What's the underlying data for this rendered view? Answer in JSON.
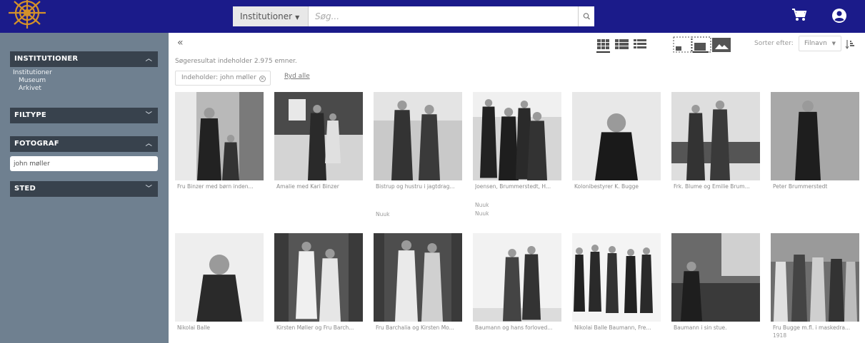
{
  "header": {
    "search_select": "Institutioner",
    "search_placeholder": "Søg..."
  },
  "sidebar": {
    "institutioner": {
      "title": "INSTITUTIONER",
      "root": "Institutioner",
      "items": [
        "Museum",
        "Arkivet"
      ]
    },
    "filtype": {
      "title": "FILTYPE"
    },
    "fotograf": {
      "title": "FOTOGRAF",
      "value": "john møller"
    },
    "sted": {
      "title": "STED"
    }
  },
  "results": {
    "summary": "Søgeresultat indeholder 2.975 emner.",
    "chip": "Indeholder: john møller",
    "clear_all": "Ryd alle"
  },
  "sort": {
    "label": "Sorter efter:",
    "value": "Filnavn"
  },
  "items": [
    {
      "caption": "Fru Binzer med børn inden...",
      "meta": []
    },
    {
      "caption": "Amalie med Kari Binzer",
      "meta": []
    },
    {
      "caption": "Bistrup og hustru i jagtdrag...",
      "meta": [
        "Nuuk"
      ]
    },
    {
      "caption": "Joensen, Brummerstedt, H...",
      "meta": [
        "Nuuk",
        "Nuuk"
      ]
    },
    {
      "caption": "Kolonibestyrer K. Bugge",
      "meta": []
    },
    {
      "caption": "Frk. Blume og Emilie Brum...",
      "meta": []
    },
    {
      "caption": "Peter Brummerstedt",
      "meta": []
    },
    {
      "caption": "Nikolai Balle",
      "meta": []
    },
    {
      "caption": "Kirsten Møller og Fru Barch...",
      "meta": []
    },
    {
      "caption": "Fru Barchalia og Kirsten Mo...",
      "meta": []
    },
    {
      "caption": "Baumann og hans forloved...",
      "meta": []
    },
    {
      "caption": "Nikolai Balle Baumann, Fre...",
      "meta": []
    },
    {
      "caption": "Baumann i sin stue.",
      "meta": []
    },
    {
      "caption": "Fru Bugge m.fl. i maskedra...",
      "meta": [
        "1918"
      ]
    }
  ],
  "colors": {
    "header": "#1b1b8a",
    "sidebar": "#6f8090",
    "filter_head": "#38424d",
    "logo": "#d4912a"
  },
  "icons": [
    "logo-icon",
    "caret-down-icon",
    "search-icon",
    "cart-icon",
    "user-icon",
    "chevron-up-icon",
    "chevron-down-icon",
    "collapse-icon",
    "grid-view-icon",
    "tile-view-icon",
    "list-view-icon",
    "small-thumb-icon",
    "medium-thumb-icon",
    "large-thumb-icon",
    "sort-direction-icon",
    "remove-icon"
  ]
}
